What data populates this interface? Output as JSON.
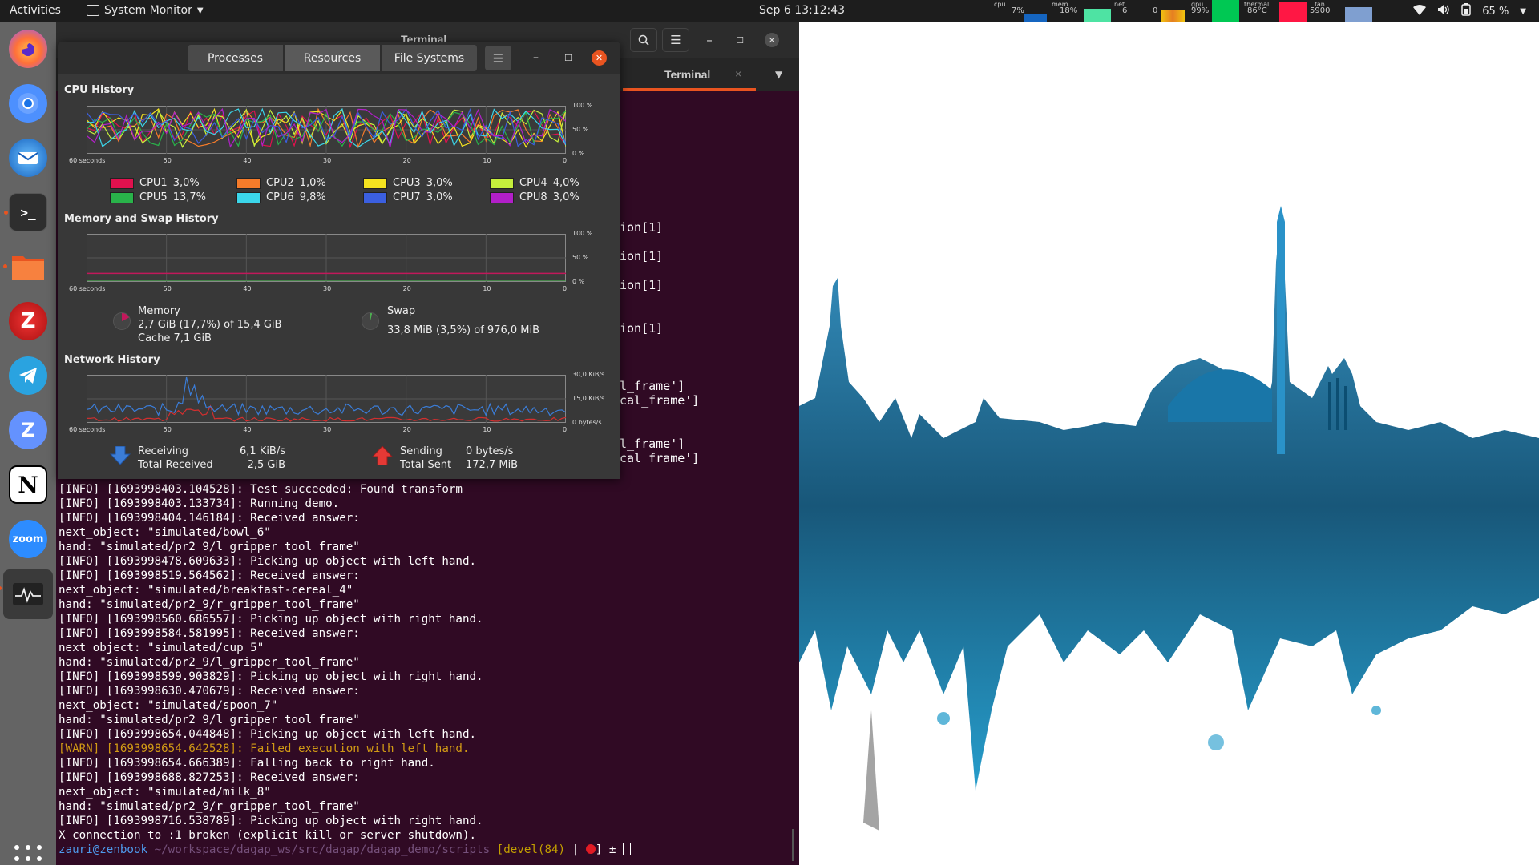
{
  "topbar": {
    "activities": "Activities",
    "app_menu": "System Monitor",
    "clock": "Sep 6  13:12:43",
    "monitors": {
      "cpu_label": "cpu",
      "cpu_value": "7%",
      "mem_label": "mem",
      "mem_value": "18%",
      "net_label": "net",
      "net_in": "6",
      "net_out": "0",
      "gpu_label": "gpu",
      "gpu_value": "99%",
      "thermal_label": "thermal",
      "thermal_value": "86°C",
      "fan_label": "fan",
      "fan_value": "5900"
    },
    "battery": "65 %"
  },
  "dock": {
    "items": [
      "Firefox",
      "Chromium",
      "Thunderbird",
      "Terminal",
      "Files",
      "Zotero",
      "Telegram",
      "Zulip",
      "Notion",
      "Zoom",
      "System Monitor"
    ],
    "zoom_label": "zoom",
    "notion_letter": "N",
    "zotero_letter": "Z",
    "zulip_letter": "Z"
  },
  "terminal": {
    "title": "Terminal",
    "tab_label": "Terminal",
    "tab_close": "×",
    "peek_lines": [
      "ion[1]",
      "ion[1]",
      "ion[1]",
      "ion[1]",
      "l_frame']",
      "cal_frame']",
      "l_frame']",
      "cal_frame']"
    ],
    "lines": [
      {
        "text": "[INFO] [1693998403.104528]: Test succeeded: Found transform",
        "level": "info"
      },
      {
        "text": "[INFO] [1693998403.133734]: Running demo.",
        "level": "info"
      },
      {
        "text": "[INFO] [1693998404.146184]: Received answer:",
        "level": "info"
      },
      {
        "text": "next_object: \"simulated/bowl_6\"",
        "level": "info"
      },
      {
        "text": "hand: \"simulated/pr2_9/l_gripper_tool_frame\"",
        "level": "info"
      },
      {
        "text": "[INFO] [1693998478.609633]: Picking up object with left hand.",
        "level": "info"
      },
      {
        "text": "[INFO] [1693998519.564562]: Received answer:",
        "level": "info"
      },
      {
        "text": "next_object: \"simulated/breakfast-cereal_4\"",
        "level": "info"
      },
      {
        "text": "hand: \"simulated/pr2_9/r_gripper_tool_frame\"",
        "level": "info"
      },
      {
        "text": "[INFO] [1693998560.686557]: Picking up object with right hand.",
        "level": "info"
      },
      {
        "text": "[INFO] [1693998584.581995]: Received answer:",
        "level": "info"
      },
      {
        "text": "next_object: \"simulated/cup_5\"",
        "level": "info"
      },
      {
        "text": "hand: \"simulated/pr2_9/l_gripper_tool_frame\"",
        "level": "info"
      },
      {
        "text": "[INFO] [1693998599.903829]: Picking up object with right hand.",
        "level": "info"
      },
      {
        "text": "[INFO] [1693998630.470679]: Received answer:",
        "level": "info"
      },
      {
        "text": "next_object: \"simulated/spoon_7\"",
        "level": "info"
      },
      {
        "text": "hand: \"simulated/pr2_9/l_gripper_tool_frame\"",
        "level": "info"
      },
      {
        "text": "[INFO] [1693998654.044848]: Picking up object with left hand.",
        "level": "info"
      },
      {
        "text": "[WARN] [1693998654.642528]: Failed execution with left hand.",
        "level": "warn"
      },
      {
        "text": "[INFO] [1693998654.666389]: Falling back to right hand.",
        "level": "info"
      },
      {
        "text": "[INFO] [1693998688.827253]: Received answer:",
        "level": "info"
      },
      {
        "text": "next_object: \"simulated/milk_8\"",
        "level": "info"
      },
      {
        "text": "hand: \"simulated/pr2_9/r_gripper_tool_frame\"",
        "level": "info"
      },
      {
        "text": "[INFO] [1693998716.538789]: Picking up object with right hand.",
        "level": "info"
      },
      {
        "text": "X connection to :1 broken (explicit kill or server shutdown).",
        "level": "info"
      }
    ],
    "prompt": {
      "user": "zauri@zenbook",
      "path": " ~/workspace/dagap_ws/src/dagap/dagap_demo/scripts",
      "branch": " [devel(84)",
      "sep": " | ",
      "tail": "] ± "
    }
  },
  "system_monitor": {
    "tabs": [
      "Processes",
      "Resources",
      "File Systems"
    ],
    "active_tab": "Resources",
    "cpu": {
      "title": "CPU History",
      "x_ticks": [
        "60 seconds",
        "50",
        "40",
        "30",
        "20",
        "10",
        "0"
      ],
      "y_ticks": [
        "100 %",
        "50 %",
        "0 %"
      ],
      "cores": [
        {
          "label": "CPU1",
          "value": "3,0%",
          "color": "#e0114e"
        },
        {
          "label": "CPU2",
          "value": "1,0%",
          "color": "#f57b2a"
        },
        {
          "label": "CPU3",
          "value": "3,0%",
          "color": "#f5e31f"
        },
        {
          "label": "CPU4",
          "value": "4,0%",
          "color": "#c6ef3c"
        },
        {
          "label": "CPU5",
          "value": "13,7%",
          "color": "#29b34a"
        },
        {
          "label": "CPU6",
          "value": "9,8%",
          "color": "#3bd6ea"
        },
        {
          "label": "CPU7",
          "value": "3,0%",
          "color": "#3b5fe0"
        },
        {
          "label": "CPU8",
          "value": "3,0%",
          "color": "#b21fc9"
        }
      ]
    },
    "memory": {
      "title": "Memory and Swap History",
      "x_ticks": [
        "60 seconds",
        "50",
        "40",
        "30",
        "20",
        "10",
        "0"
      ],
      "y_ticks": [
        "100 %",
        "50 %",
        "0 %"
      ],
      "mem_label": "Memory",
      "mem_value": "2,7 GiB (17,7%) of 15,4 GiB",
      "mem_cache": "Cache 7,1 GiB",
      "mem_color": "#c2185b",
      "mem_fraction": 0.177,
      "swap_label": "Swap",
      "swap_value": "33,8 MiB (3,5%) of 976,0 MiB",
      "swap_color": "#4caf50",
      "swap_fraction": 0.035
    },
    "network": {
      "title": "Network History",
      "x_ticks": [
        "60 seconds",
        "50",
        "40",
        "30",
        "20",
        "10",
        "0"
      ],
      "y_ticks": [
        "30,0 KiB/s",
        "15,0 KiB/s",
        "0 bytes/s"
      ],
      "receiving_label": "Receiving",
      "receiving_value": "6,1 KiB/s",
      "total_received_label": "Total Received",
      "total_received_value": "2,5 GiB",
      "sending_label": "Sending",
      "sending_value": "0 bytes/s",
      "total_sent_label": "Total Sent",
      "total_sent_value": "172,7 MiB",
      "receive_color": "#3b7dd8",
      "send_color": "#d32f2f"
    }
  }
}
